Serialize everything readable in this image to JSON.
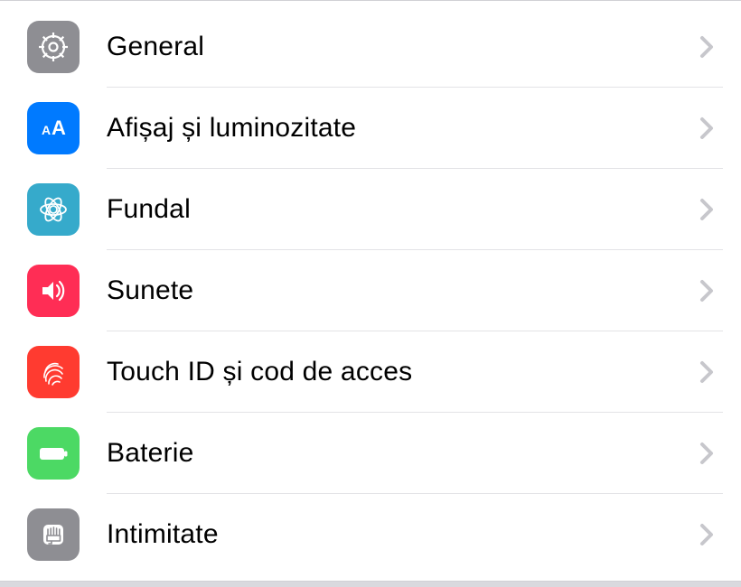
{
  "settings": {
    "items": [
      {
        "label": "General",
        "icon": "gear-icon",
        "bg": "bg-gray"
      },
      {
        "label": "Afișaj și luminozitate",
        "icon": "display-icon",
        "bg": "bg-blue"
      },
      {
        "label": "Fundal",
        "icon": "wallpaper-icon",
        "bg": "bg-cyan"
      },
      {
        "label": "Sunete",
        "icon": "sounds-icon",
        "bg": "bg-red"
      },
      {
        "label": "Touch ID și cod de acces",
        "icon": "fingerprint-icon",
        "bg": "bg-redb"
      },
      {
        "label": "Baterie",
        "icon": "battery-icon",
        "bg": "bg-green"
      },
      {
        "label": "Intimitate",
        "icon": "privacy-icon",
        "bg": "bg-gray2"
      }
    ]
  }
}
